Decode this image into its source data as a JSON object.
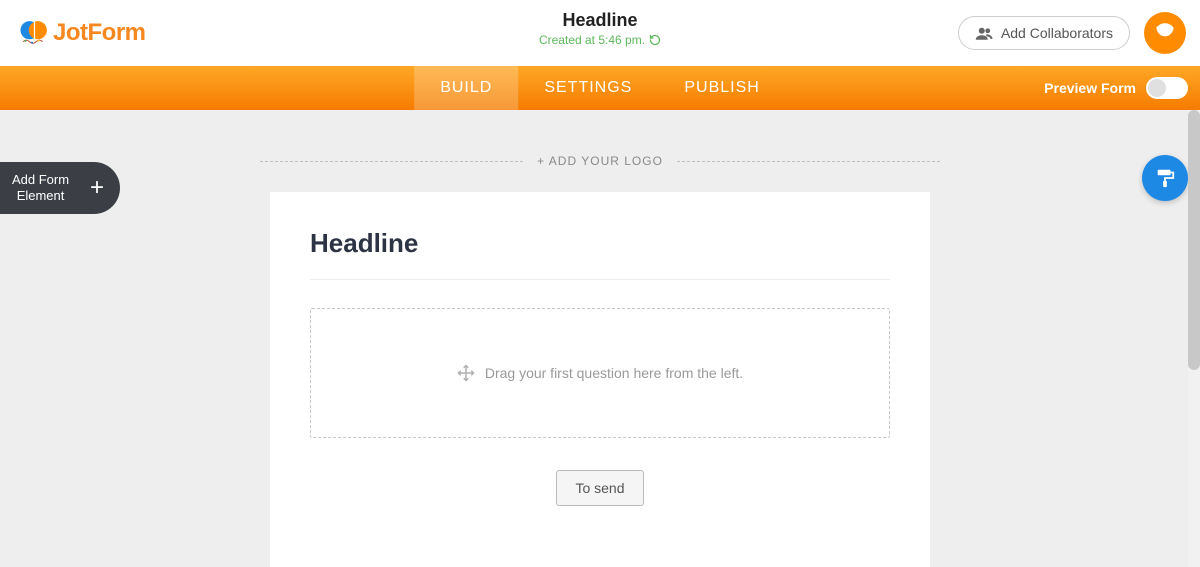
{
  "header": {
    "logo_text_1": "Jot",
    "logo_text_2": "Form",
    "form_title": "Headline",
    "created_label": "Created at 5:46 pm.",
    "collab_label": "Add Collaborators"
  },
  "nav": {
    "tabs": [
      {
        "label": "BUILD",
        "active": true
      },
      {
        "label": "SETTINGS",
        "active": false
      },
      {
        "label": "PUBLISH",
        "active": false
      }
    ],
    "preview_label": "Preview Form"
  },
  "sidebar": {
    "add_element_line1": "Add Form",
    "add_element_line2": "Element"
  },
  "canvas": {
    "add_logo_label": "+ ADD YOUR LOGO",
    "form_heading": "Headline",
    "drop_hint": "Drag your first question here from the left.",
    "submit_label": "To send"
  }
}
